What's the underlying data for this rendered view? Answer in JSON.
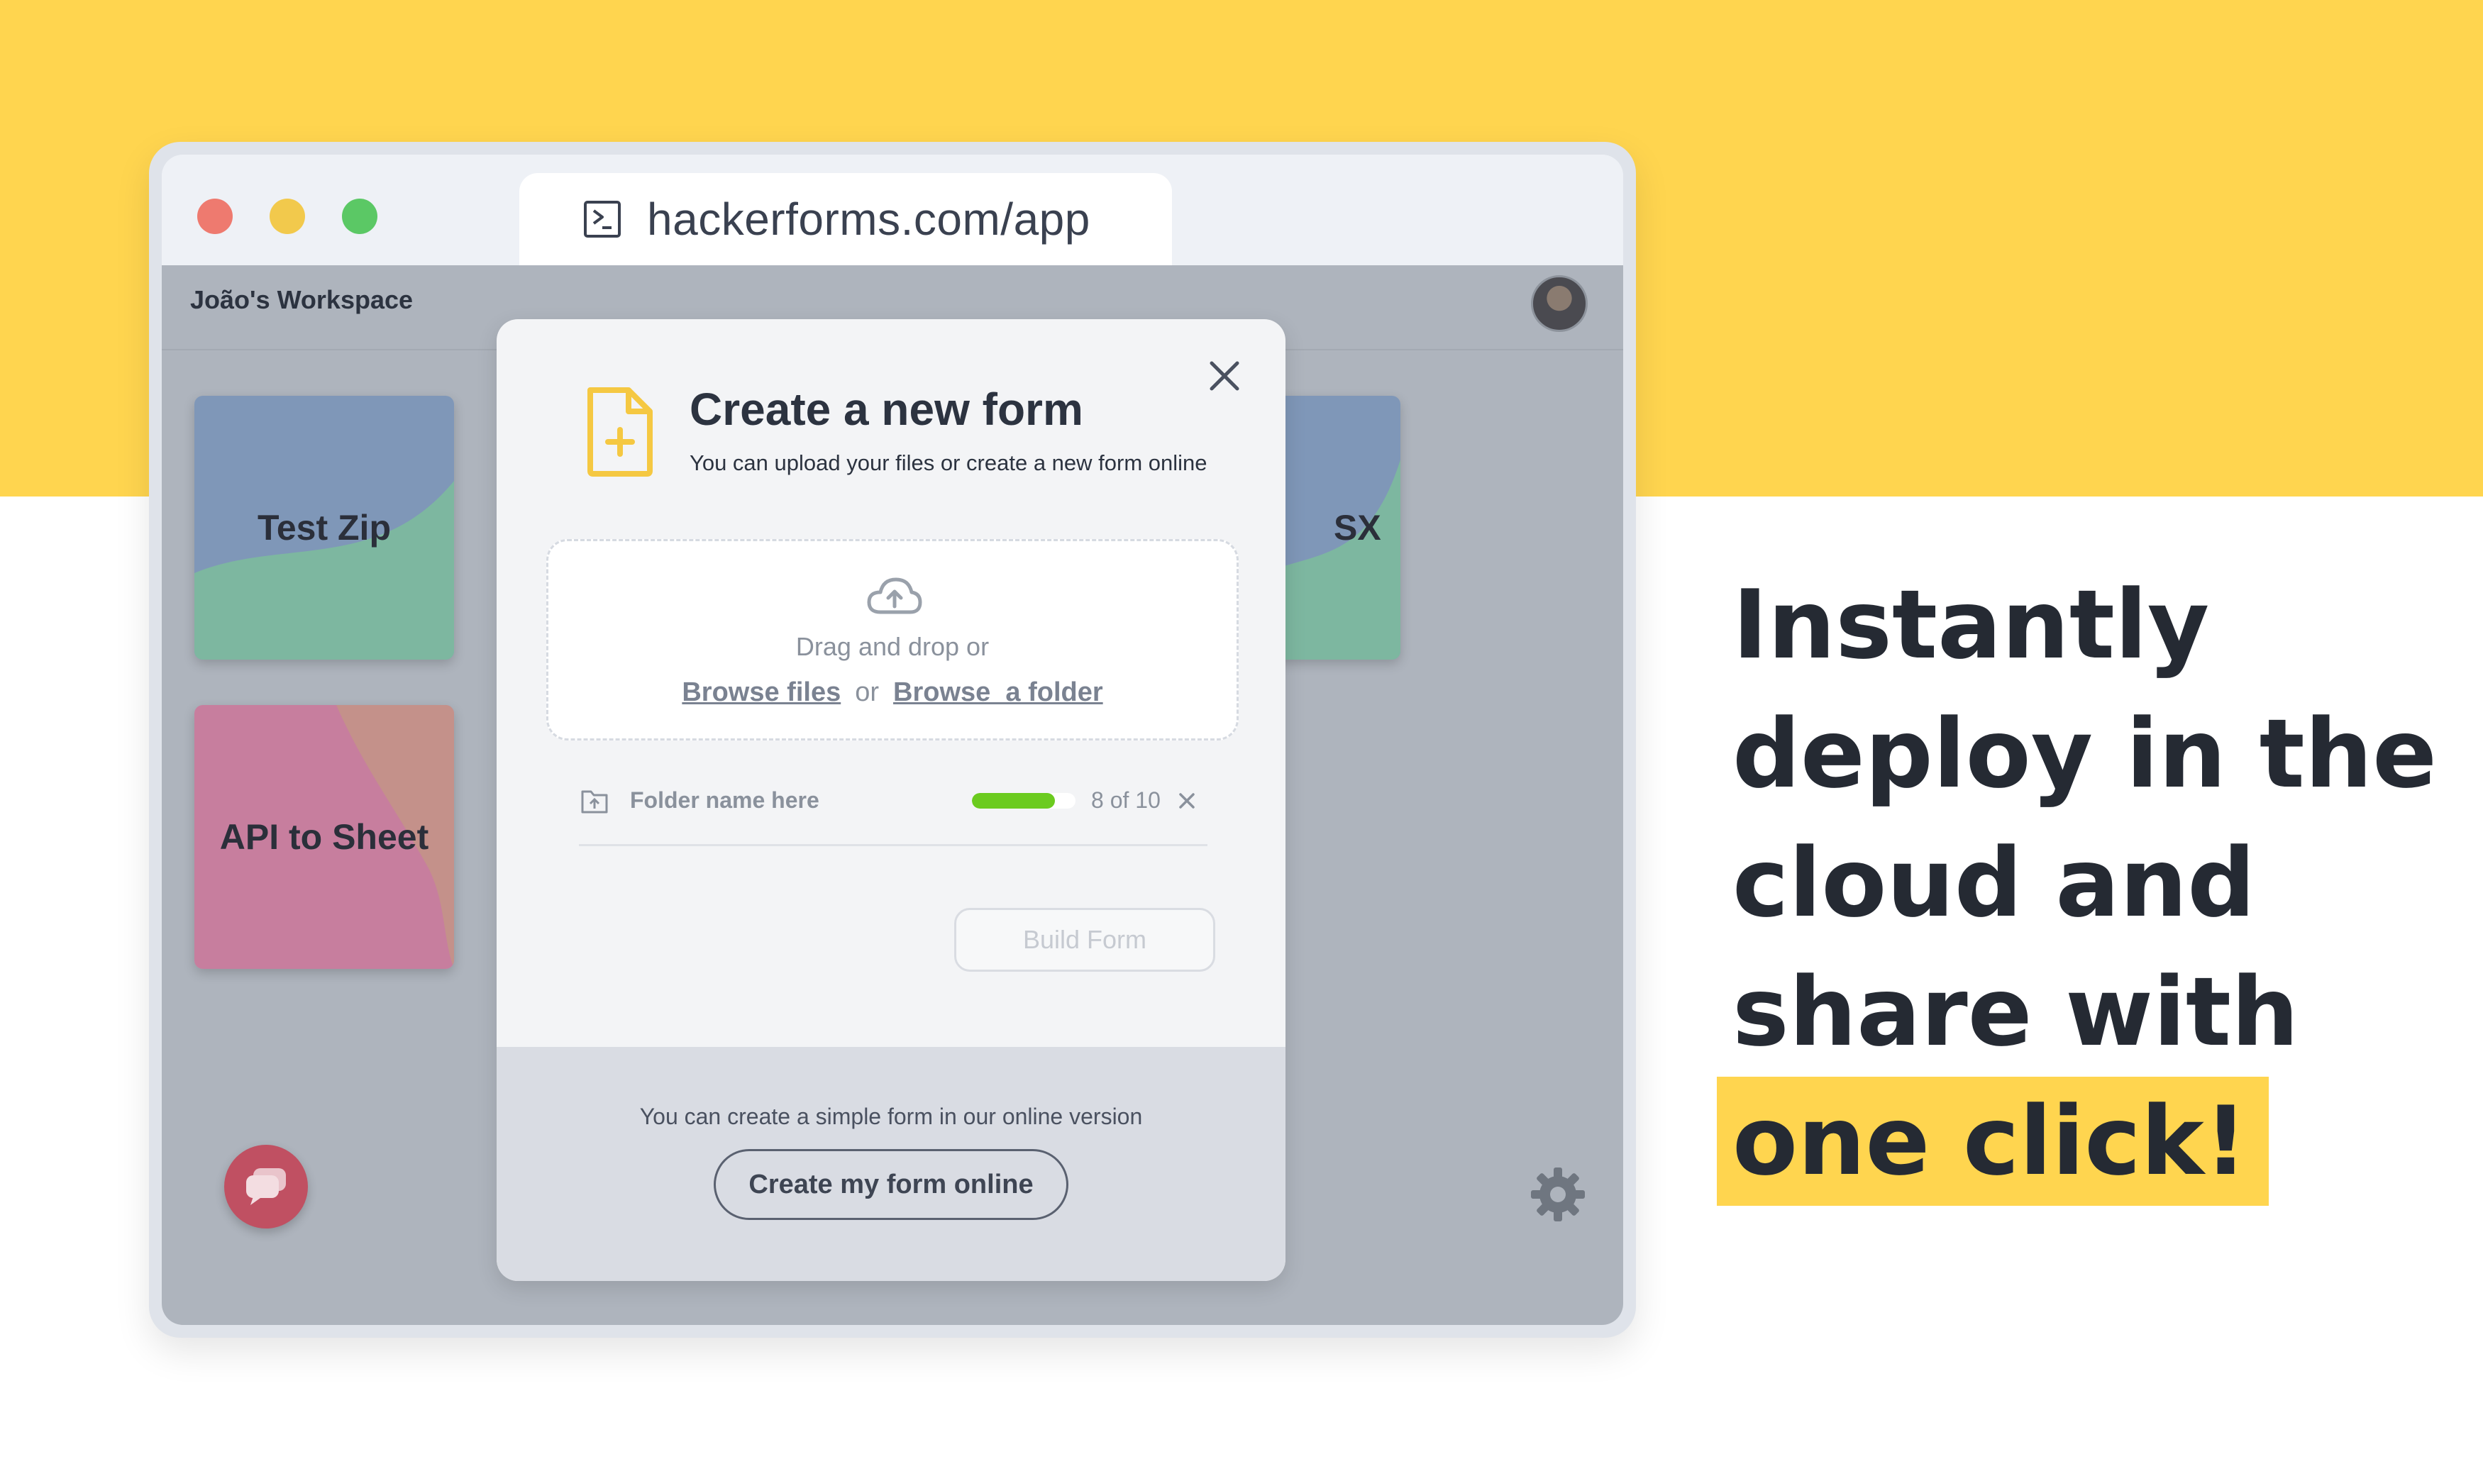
{
  "browser": {
    "url": "hackerforms.com/app",
    "window_controls": [
      "close",
      "minimize",
      "maximize"
    ]
  },
  "app": {
    "workspace_title": "João's Workspace",
    "cards": [
      {
        "label": "Test Zip",
        "colors": [
          "#7F97B8",
          "#7DB7A0"
        ]
      },
      {
        "label": "API to Sheet",
        "colors": [
          "#C77E9E",
          "#C4918A"
        ]
      },
      {
        "label": "SX",
        "colors": [
          "#7F97B8",
          "#7DB7A0"
        ]
      }
    ]
  },
  "modal": {
    "title": "Create a new form",
    "subtitle": "You can upload your files or create a new form online",
    "dropzone": {
      "prompt": "Drag and drop or",
      "browse_files": "Browse files",
      "or": "or",
      "browse_folder": "Browse  a folder"
    },
    "upload": {
      "folder_name": "Folder name here",
      "progress": 0.8,
      "count": "8 of 10"
    },
    "build_button": "Build Form",
    "footer_text": "You can create a simple form in our online version",
    "online_button": "Create my form online"
  },
  "headline": {
    "lines": [
      "Instantly",
      "deploy in the",
      "cloud and",
      "share with"
    ],
    "highlight": "one click!"
  },
  "colors": {
    "brand_yellow": "#FFD54F",
    "text_dark": "#252a33",
    "progress_green": "#6BCB1F",
    "chat_fab": "#C05062"
  },
  "icons": [
    "terminal-icon",
    "avatar",
    "file-plus-icon",
    "close-icon",
    "cloud-upload-icon",
    "folder-upload-icon",
    "remove-icon",
    "chat-icon",
    "gear-icon"
  ]
}
